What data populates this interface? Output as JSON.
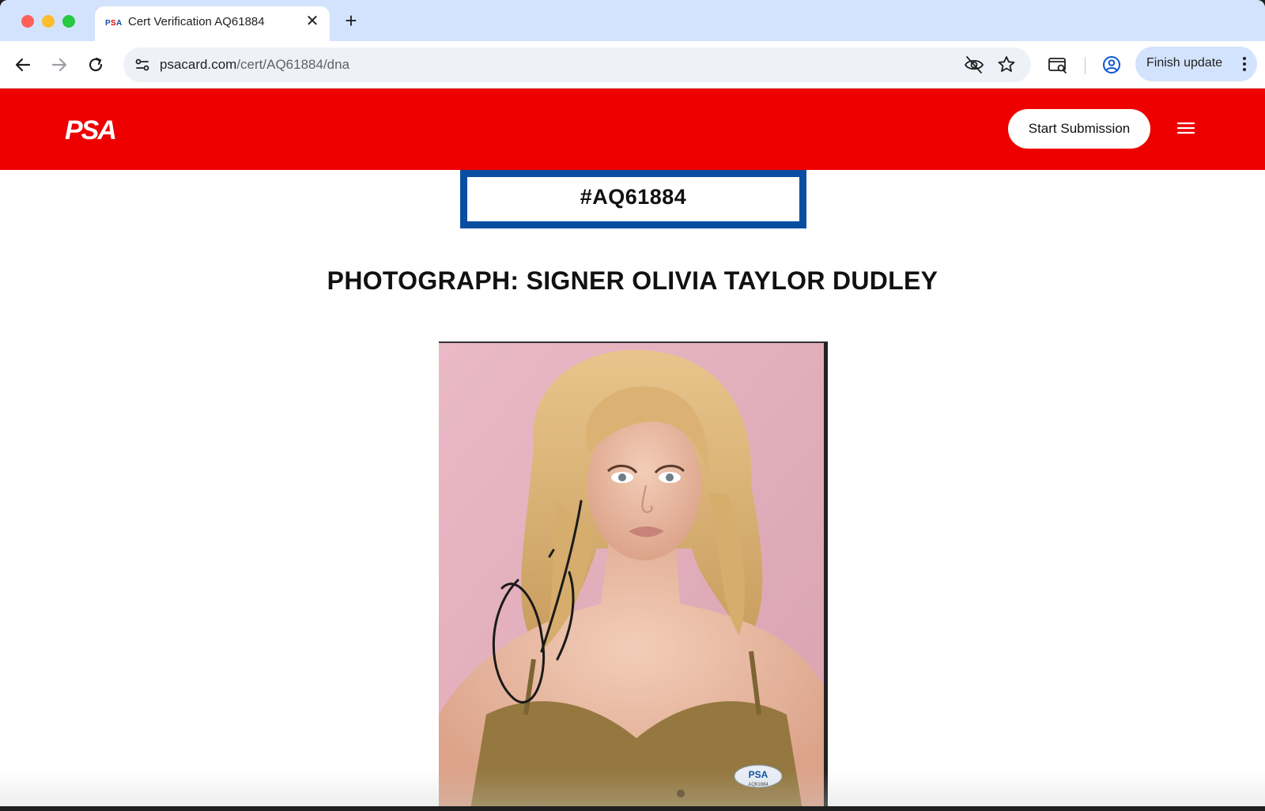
{
  "browser": {
    "tab": {
      "title": "Cert Verification AQ61884",
      "favicon": "psa-favicon-icon"
    },
    "url": {
      "host": "psacard.com",
      "path": "/cert/AQ61884/dna"
    },
    "finish_update_label": "Finish update",
    "colors": {
      "tabstrip": "#d3e3fd",
      "omnibox": "#eef2f8"
    }
  },
  "site": {
    "logo_text": "PSA",
    "start_submission_label": "Start Submission",
    "colors": {
      "brand_red": "#ee0000",
      "cert_border": "#0a4ea2"
    }
  },
  "cert": {
    "number": "#AQ61884",
    "title": "PHOTOGRAPH: SIGNER OLIVIA TAYLOR DUDLEY"
  },
  "photo": {
    "sticker_logo": "PSA",
    "sticker_cert": "AQ61884"
  }
}
